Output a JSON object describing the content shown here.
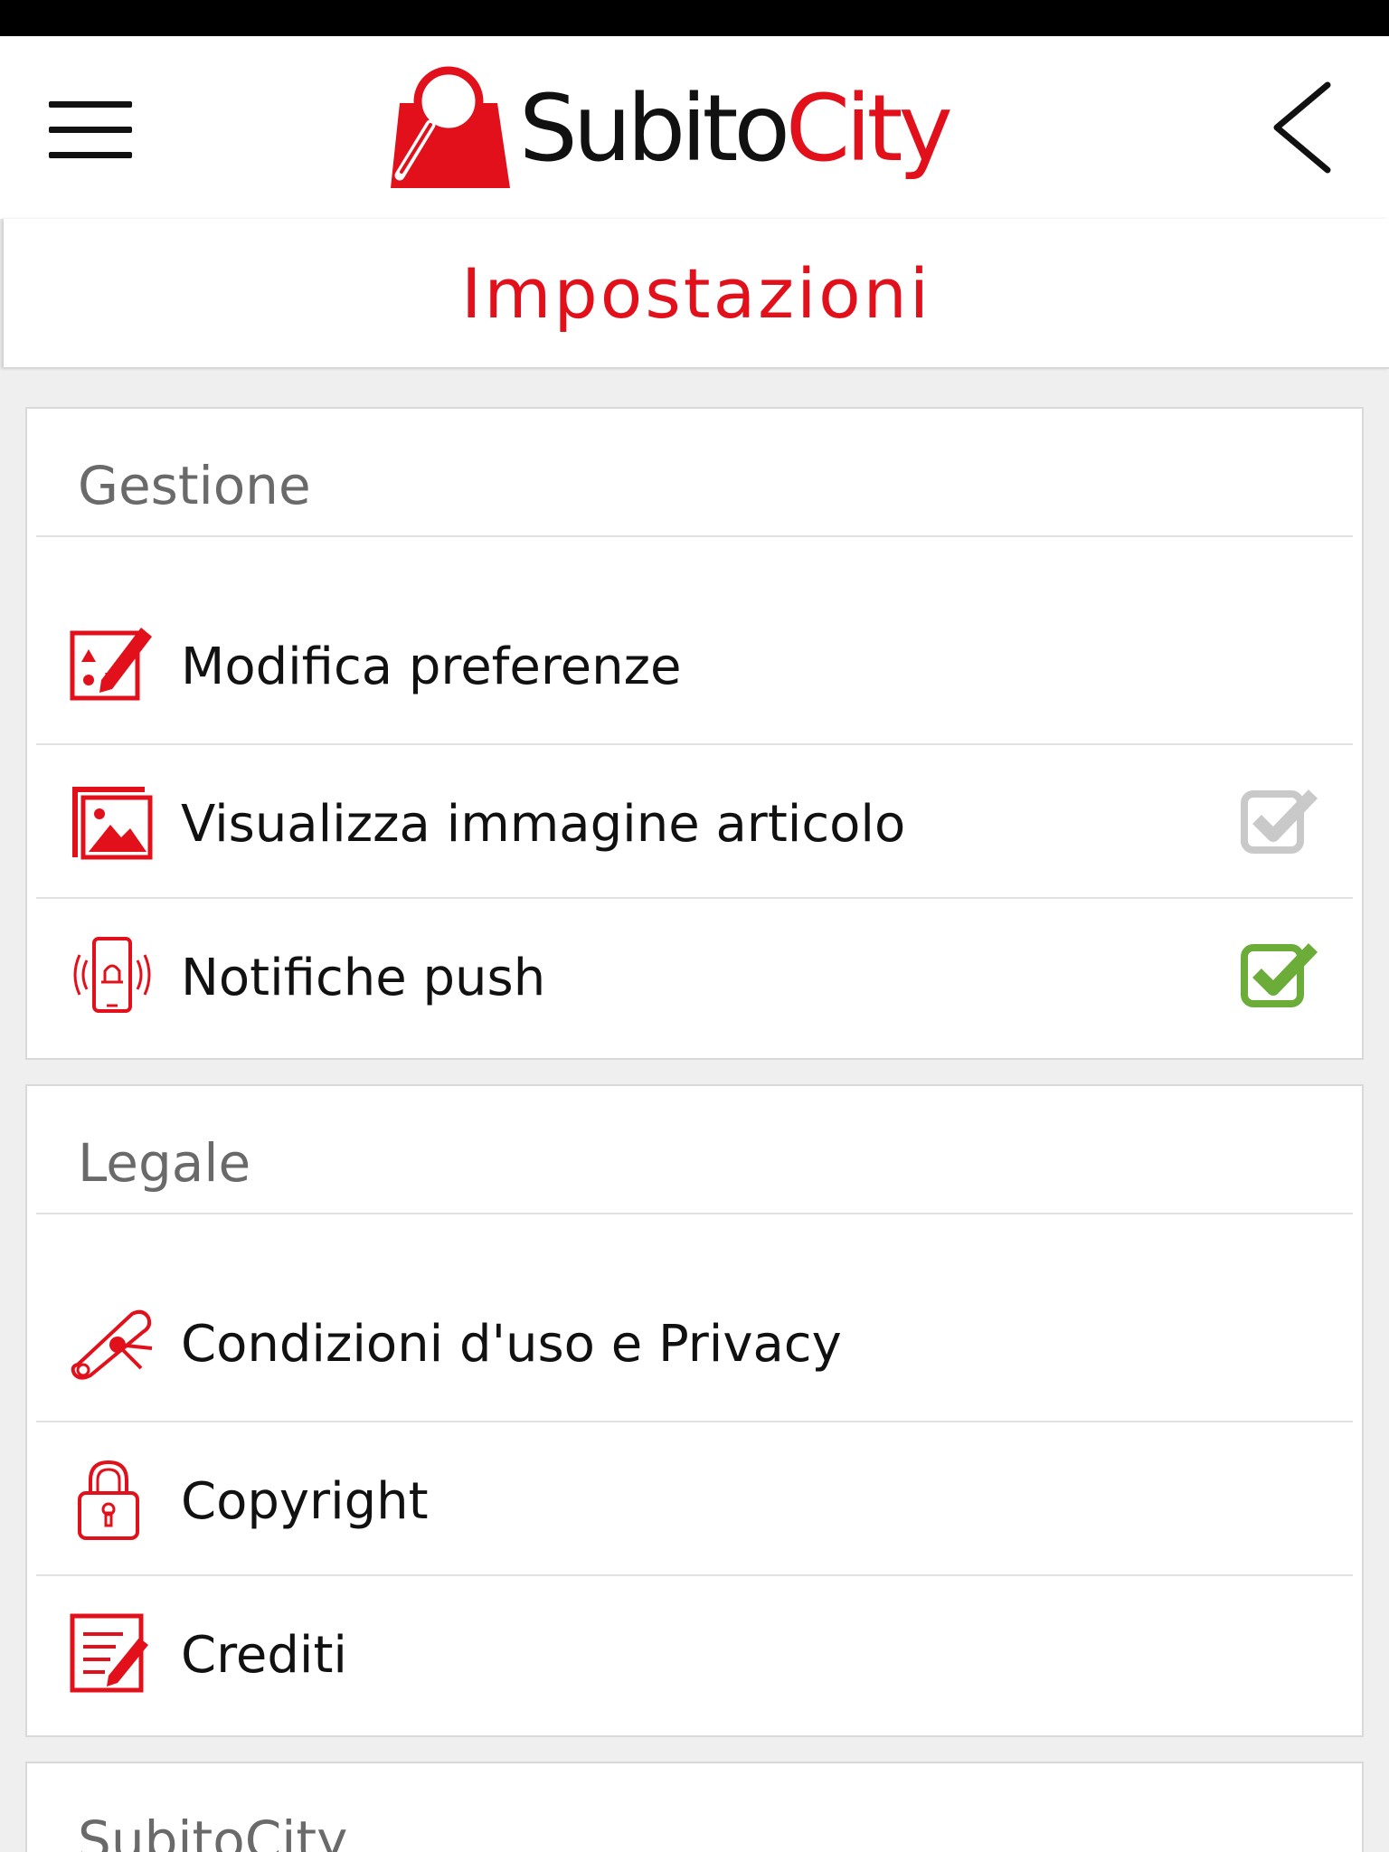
{
  "app": {
    "brand_part1": "Subito",
    "brand_part2": "City",
    "brand_color": "#e2101b"
  },
  "header": {
    "menu_icon": "hamburger-menu-icon",
    "back_icon": "chevron-left-icon",
    "page_title": "Impostazioni"
  },
  "sections": [
    {
      "title": "Gestione",
      "items": [
        {
          "label": "Modifica preferenze",
          "icon": "edit-preferences-icon"
        },
        {
          "label": "Visualizza immagine articolo",
          "icon": "image-gallery-icon",
          "checkbox": {
            "checked": true,
            "enabled": false,
            "color": "#c9c9c9"
          }
        },
        {
          "label": "Notifiche push",
          "icon": "phone-notification-icon",
          "checkbox": {
            "checked": true,
            "enabled": true,
            "color": "#6cad3a"
          }
        }
      ]
    },
    {
      "title": "Legale",
      "items": [
        {
          "label": "Condizioni d'uso e Privacy",
          "icon": "diploma-scroll-icon"
        },
        {
          "label": "Copyright",
          "icon": "padlock-icon"
        },
        {
          "label": "Crediti",
          "icon": "document-edit-icon"
        }
      ]
    },
    {
      "title": "SubitoCity",
      "items": []
    }
  ]
}
